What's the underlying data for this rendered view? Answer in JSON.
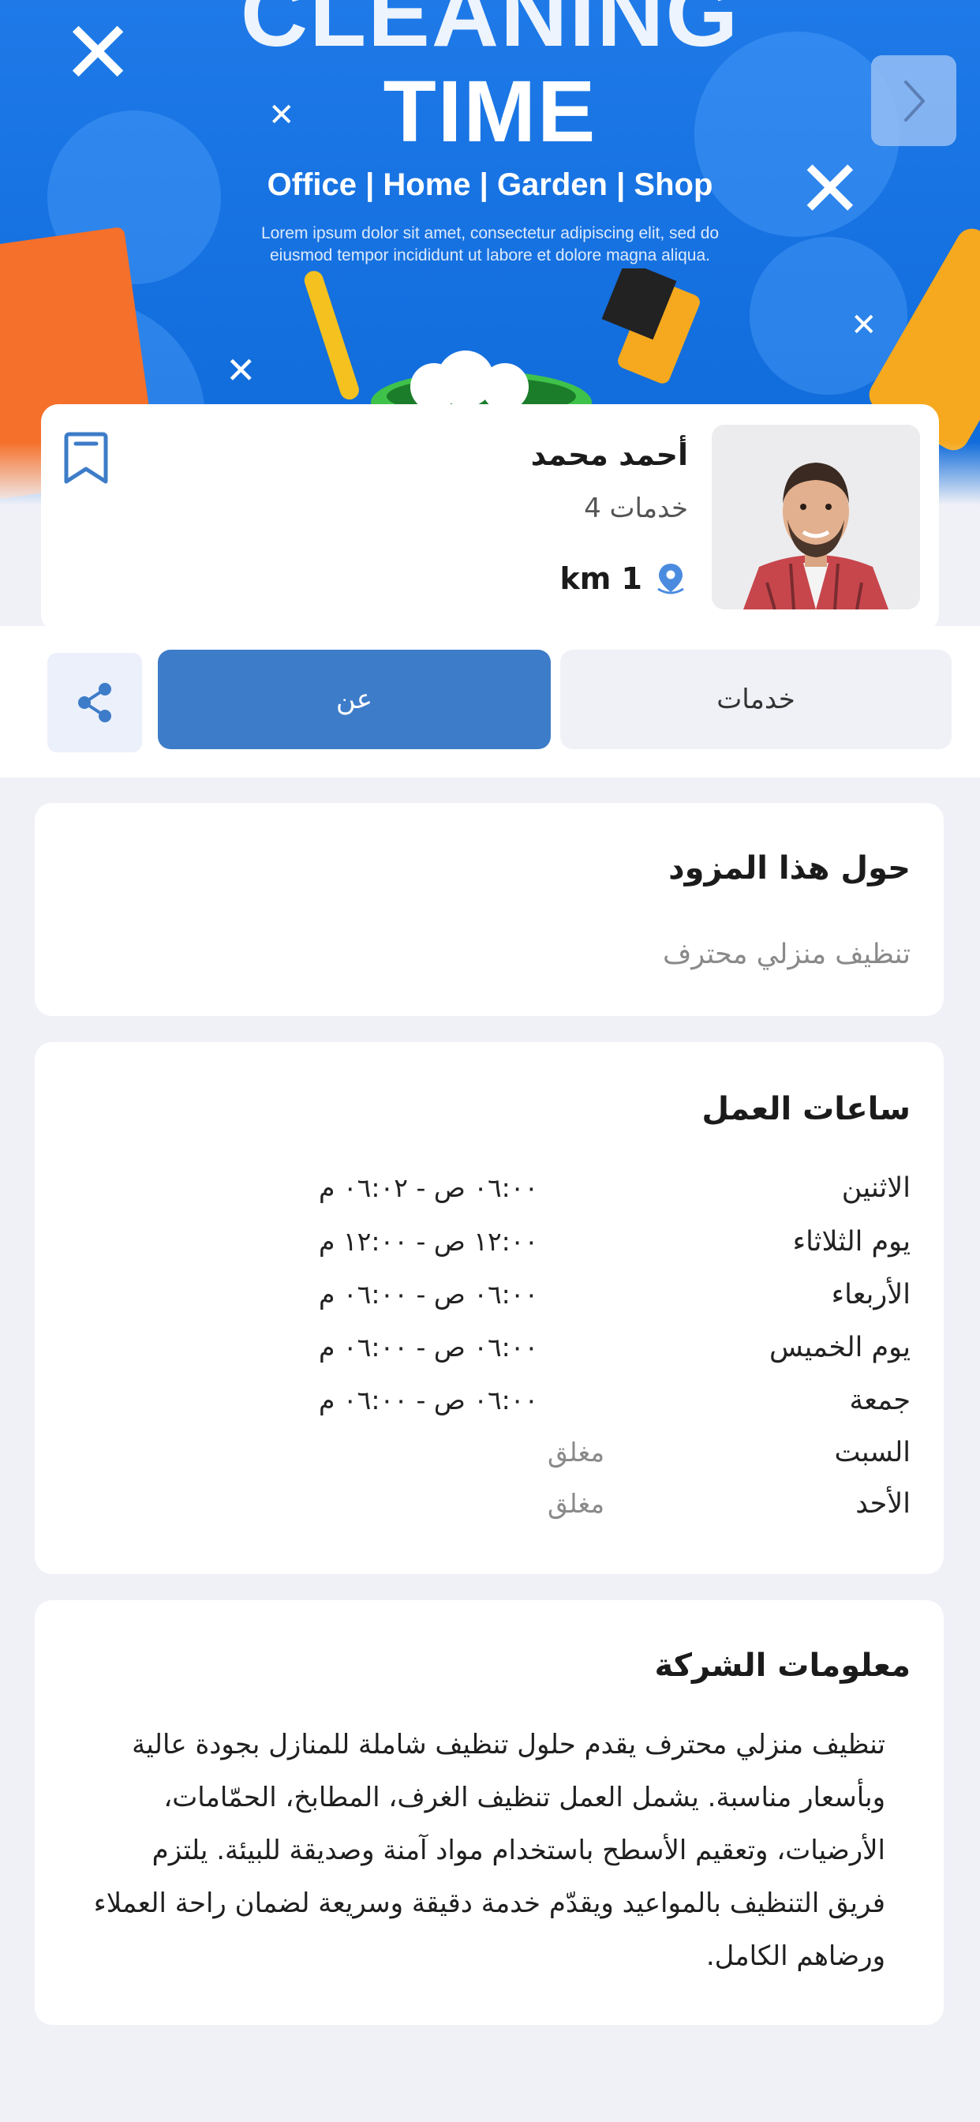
{
  "banner": {
    "title_line1": "CLEANING",
    "title_line2": "TIME",
    "subtitle": "Office | Home | Garden | Shop",
    "body": "Lorem ipsum dolor sit amet, consectetur adipiscing elit, sed do eiusmod tempor incididunt ut labore et dolore magna aliqua.",
    "next_icon": "chevron-right-icon"
  },
  "provider": {
    "name": "أحمد محمد",
    "services_count": "4 خدمات",
    "distance": "km 1",
    "location_icon": "location-pin-icon",
    "bookmark_icon": "bookmark-icon"
  },
  "tabs": {
    "services_label": "خدمات",
    "about_label": "عن",
    "share_icon": "share-icon",
    "active": "about"
  },
  "about": {
    "title": "حول هذا المزود",
    "text": "تنظيف منزلي محترف"
  },
  "hours": {
    "title": "ساعات العمل",
    "rows": [
      {
        "day": "الاثنين",
        "time": "٠٦:٠٠ ص  -  ٠٦:٠٢ م"
      },
      {
        "day": "يوم الثلاثاء",
        "time": "١٢:٠٠ ص  -  ١٢:٠٠ م"
      },
      {
        "day": "الأربعاء",
        "time": "٠٦:٠٠ ص  -  ٠٦:٠٠ م"
      },
      {
        "day": "يوم الخميس",
        "time": "٠٦:٠٠ ص  -  ٠٦:٠٠ م"
      },
      {
        "day": "جمعة",
        "time": "٠٦:٠٠ ص  -  ٠٦:٠٠ م"
      },
      {
        "day": "السبت",
        "closed": "مغلق"
      },
      {
        "day": "الأحد",
        "closed": "مغلق"
      }
    ]
  },
  "company": {
    "title": "معلومات الشركة",
    "text": "تنظيف منزلي محترف يقدم حلول تنظيف شاملة للمنازل بجودة عالية وبأسعار مناسبة. يشمل العمل تنظيف الغرف، المطابخ، الحمّامات، الأرضيات، وتعقيم الأسطح باستخدام مواد آمنة وصديقة للبيئة. يلتزم فريق التنظيف بالمواعيد ويقدّم خدمة دقيقة وسريعة لضمان راحة العملاء ورضاهم الكامل."
  },
  "colors": {
    "accent": "#3d7cc8",
    "banner_blue": "#1570e0",
    "page_bg": "#f0f1f7"
  }
}
